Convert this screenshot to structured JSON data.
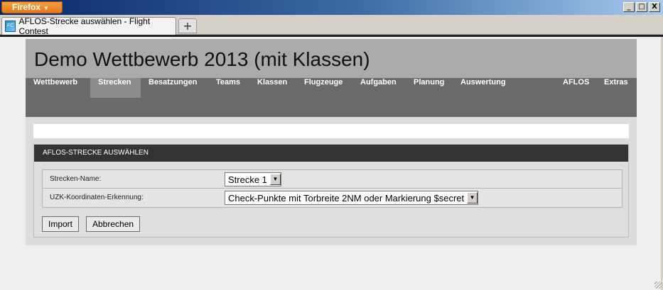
{
  "browser": {
    "menu_button": "Firefox",
    "tab_title": "AFLOS-Strecke auswählen - Flight Contest",
    "new_tab_label": "+",
    "window_controls": {
      "minimize": "_",
      "maximize": "□",
      "close": "X"
    }
  },
  "page": {
    "title": "Demo Wettbewerb 2013 (mit Klassen)",
    "nav": [
      "Wettbewerb",
      "Strecken",
      "Besatzungen",
      "Teams",
      "Klassen",
      "Flugzeuge",
      "Aufgaben",
      "Planung",
      "Auswertung",
      "AFLOS",
      "Extras"
    ],
    "active_nav": "Strecken",
    "panel_title": "AFLOS-STRECKE AUSWÄHLEN",
    "form": {
      "route_name_label": "Strecken-Name:",
      "route_name_value": "Strecke 1",
      "detection_label": "UZK-Koordinaten-Erkennung:",
      "detection_value": "Check-Punkte mit Torbreite 2NM oder Markierung $secret"
    },
    "buttons": {
      "import": "Import",
      "cancel": "Abbrechen"
    }
  }
}
